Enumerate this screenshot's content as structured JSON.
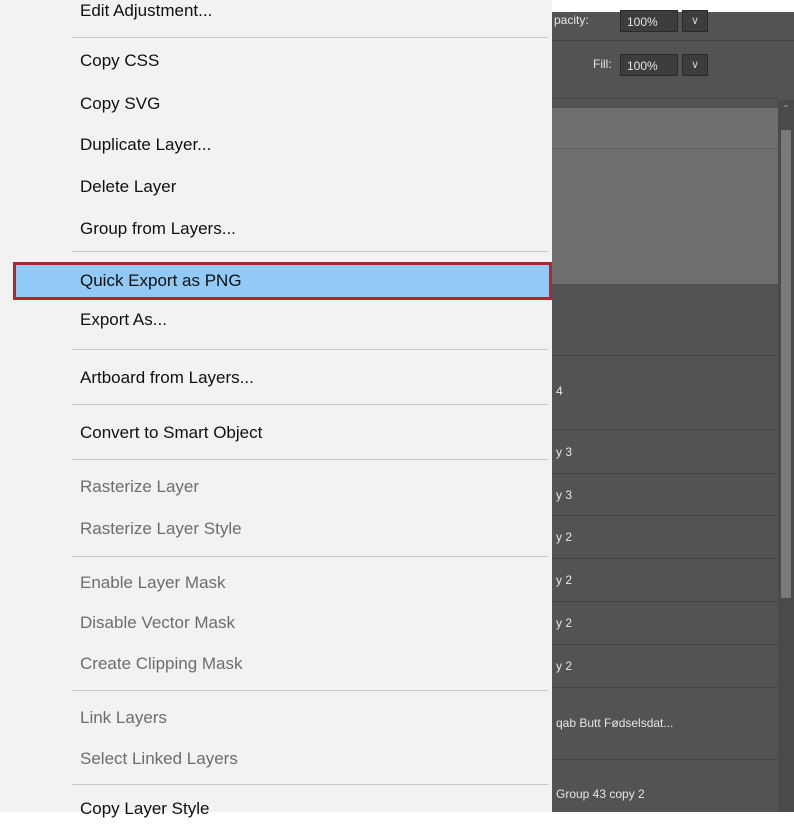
{
  "layers_panel": {
    "opacity_label": "pacity:",
    "opacity_value": "100%",
    "fill_label": "Fill:",
    "fill_value": "100%",
    "layer_rows": [
      "4",
      "y 3",
      "y 3",
      "y 2",
      "y 2",
      "y 2",
      "y 2",
      "qab Butt Fødselsdat...",
      "Group 43 copy 2"
    ]
  },
  "context_menu": {
    "partial_top_item": "Edit Adjustment...",
    "items": [
      {
        "label": "Copy CSS",
        "enabled": true
      },
      {
        "label": "Copy SVG",
        "enabled": true
      },
      {
        "label": "Duplicate Layer...",
        "enabled": true
      },
      {
        "label": "Delete Layer",
        "enabled": true
      },
      {
        "label": "Group from Layers...",
        "enabled": true
      },
      {
        "label": "Quick Export as PNG",
        "enabled": true,
        "highlighted": true
      },
      {
        "label": "Export As...",
        "enabled": true
      },
      {
        "label": "Artboard from Layers...",
        "enabled": true
      },
      {
        "label": "Convert to Smart Object",
        "enabled": true
      },
      {
        "label": "Rasterize Layer",
        "enabled": false
      },
      {
        "label": "Rasterize Layer Style",
        "enabled": false
      },
      {
        "label": "Enable Layer Mask",
        "enabled": false
      },
      {
        "label": "Disable Vector Mask",
        "enabled": false
      },
      {
        "label": "Create Clipping Mask",
        "enabled": false
      },
      {
        "label": "Link Layers",
        "enabled": false
      },
      {
        "label": "Select Linked Layers",
        "enabled": false
      },
      {
        "label": "Copy Layer Style",
        "enabled": true
      }
    ]
  },
  "colors": {
    "highlight": "#91c9f7",
    "highlight_border": "#b3262a",
    "panel_bg": "#535353"
  }
}
